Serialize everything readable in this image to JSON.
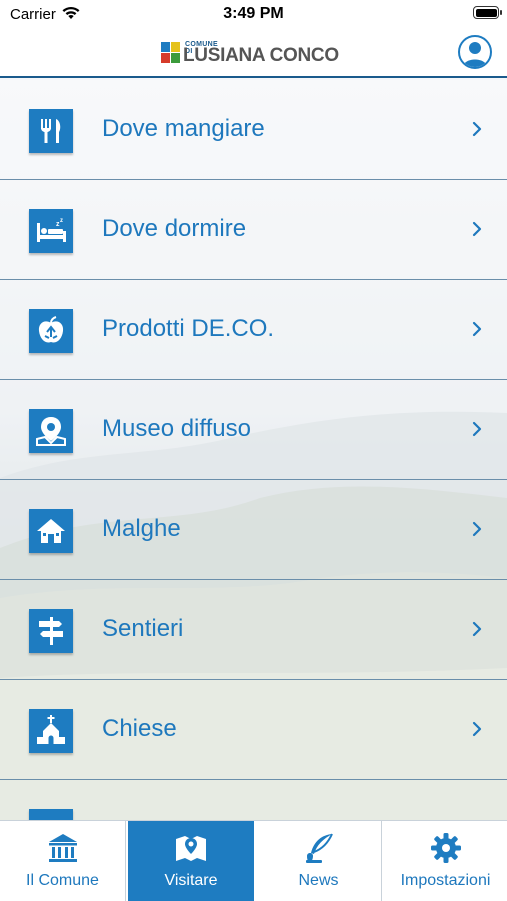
{
  "status_bar": {
    "carrier": "Carrier",
    "time": "3:49 PM"
  },
  "header": {
    "logo_small": "COMUNE DI",
    "logo_big": "LUSIANA CONCO",
    "profile_icon": "user-icon"
  },
  "colors": {
    "accent": "#1e7cc1",
    "label": "#1e78bd",
    "divider": "#6a8eaa"
  },
  "menu": {
    "items": [
      {
        "label": "Dove mangiare",
        "icon": "cutlery-icon"
      },
      {
        "label": "Dove dormire",
        "icon": "bed-icon"
      },
      {
        "label": "Prodotti DE.CO.",
        "icon": "apple-recycle-icon"
      },
      {
        "label": "Museo diffuso",
        "icon": "map-pin-icon"
      },
      {
        "label": "Malghe",
        "icon": "house-icon"
      },
      {
        "label": "Sentieri",
        "icon": "signpost-icon"
      },
      {
        "label": "Chiese",
        "icon": "church-icon"
      }
    ]
  },
  "tabbar": {
    "tabs": [
      {
        "label": "Il Comune",
        "icon": "institution-icon",
        "active": false
      },
      {
        "label": "Visitare",
        "icon": "map-icon",
        "active": true
      },
      {
        "label": "News",
        "icon": "quill-icon",
        "active": false
      },
      {
        "label": "Impostazioni",
        "icon": "gear-icon",
        "active": false
      }
    ]
  }
}
